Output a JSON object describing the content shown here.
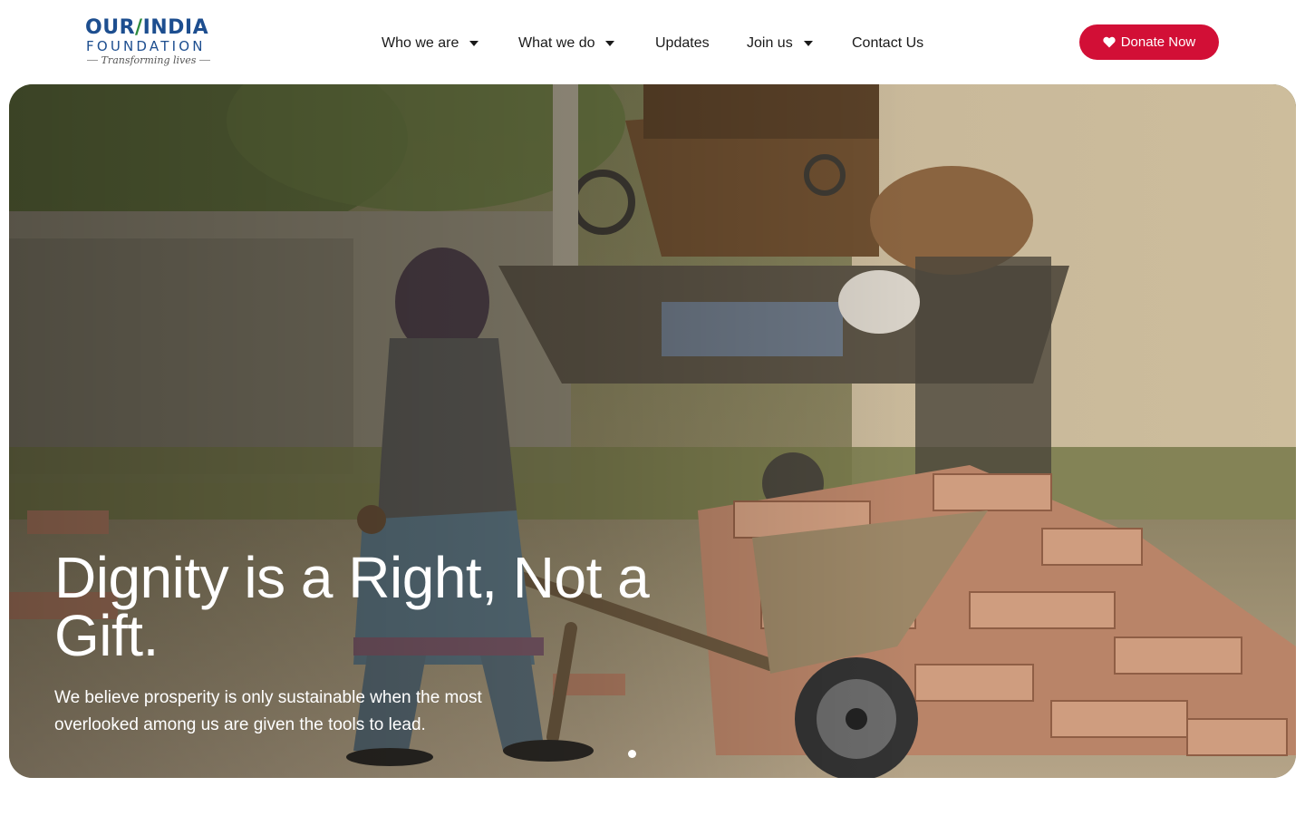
{
  "logo": {
    "line1_a": "OUR",
    "line1_b": "INDIA",
    "line2": "FOUNDATION",
    "tagline": "Transforming lives"
  },
  "nav": {
    "items": [
      {
        "label": "Who we are",
        "has_dropdown": true
      },
      {
        "label": "What we do",
        "has_dropdown": true
      },
      {
        "label": "Updates",
        "has_dropdown": false
      },
      {
        "label": "Join us",
        "has_dropdown": true
      },
      {
        "label": "Contact Us",
        "has_dropdown": false
      }
    ]
  },
  "donate": {
    "label": "Donate Now",
    "icon": "heart-icon",
    "color": "#d20f36"
  },
  "hero": {
    "title": "Dignity is a Right, Not a Gift.",
    "subtitle": "We believe prosperity is only sustainable when the most overlooked among us are given the tools to lead.",
    "slides_total": 1,
    "active_slide": 1
  },
  "colors": {
    "brand_blue": "#1d4e8f",
    "brand_green": "#2e8b3d",
    "accent_red": "#d20f36"
  }
}
